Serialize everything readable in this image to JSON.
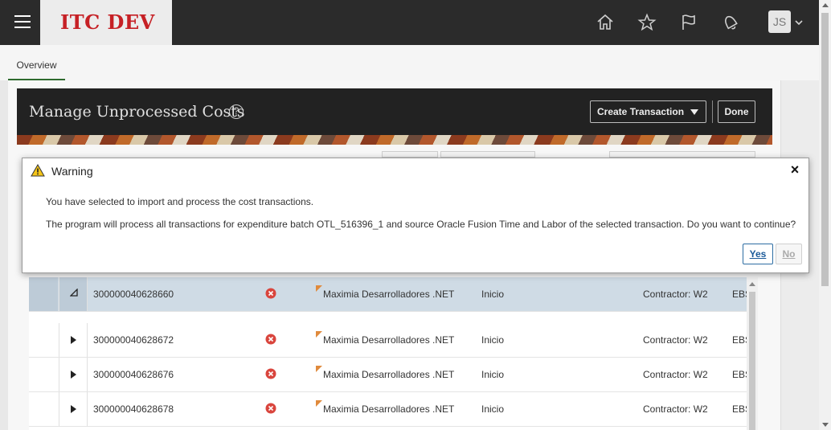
{
  "header": {
    "brand": "ITC DEV",
    "avatar_initials": "JS",
    "icons": [
      "menu-icon",
      "home-icon",
      "star-icon",
      "flag-icon",
      "bell-icon",
      "chevron-down-icon"
    ]
  },
  "tabs": [
    {
      "label": "Overview",
      "active": true
    }
  ],
  "page": {
    "title": "Manage Unprocessed Costs",
    "create_transaction_label": "Create Transaction",
    "done_label": "Done"
  },
  "dialog": {
    "title": "Warning",
    "message1": "You have selected to import and process the cost transactions.",
    "message2": "The program will process all transactions for expenditure batch OTL_516396_1 and source Oracle Fusion Time and Labor of the selected transaction. Do you want to continue?",
    "yes_label": "Yes",
    "no_label": "No",
    "close_symbol": "×"
  },
  "table": {
    "rows": [
      {
        "id": "300000040628660",
        "org": "Maximia Desarrolladores .NET",
        "status": "Inicio",
        "type": "Contractor: W2",
        "ebs": "EBS",
        "expanded": true,
        "selected": true
      },
      {
        "id": "300000040628672",
        "org": "Maximia Desarrolladores .NET",
        "status": "Inicio",
        "type": "Contractor: W2",
        "ebs": "EBS",
        "expanded": false,
        "selected": false
      },
      {
        "id": "300000040628676",
        "org": "Maximia Desarrolladores .NET",
        "status": "Inicio",
        "type": "Contractor: W2",
        "ebs": "EBS",
        "expanded": false,
        "selected": false
      },
      {
        "id": "300000040628678",
        "org": "Maximia Desarrolladores .NET",
        "status": "Inicio",
        "type": "Contractor: W2",
        "ebs": "EBS",
        "expanded": false,
        "selected": false
      }
    ]
  },
  "colors": {
    "brand_red": "#c62025",
    "header_bg": "#2b2b2b",
    "error_red": "#d9453d",
    "warning_yellow": "#f5c518",
    "link_blue": "#1b5a99"
  }
}
